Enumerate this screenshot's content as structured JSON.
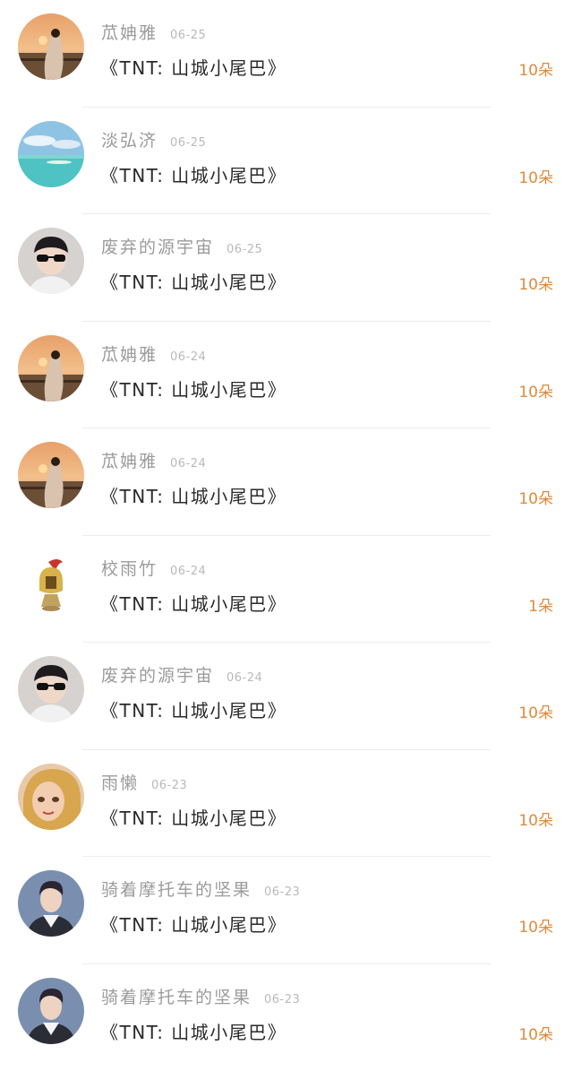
{
  "colors": {
    "accent": "#e08a3c",
    "name": "#9b9b9b",
    "date": "#b9b9b9",
    "title": "#2a2a2a"
  },
  "rows": [
    {
      "name": "苽姌雅",
      "date": "06-25",
      "title": "《TNT: 山城小尾巴》",
      "count": "10朵",
      "avatar": "sunset-girl-avatar"
    },
    {
      "name": "淡弘济",
      "date": "06-25",
      "title": "《TNT: 山城小尾巴》",
      "count": "10朵",
      "avatar": "sea-avatar"
    },
    {
      "name": "废弃的源宇宙",
      "date": "06-25",
      "title": "《TNT: 山城小尾巴》",
      "count": "10朵",
      "avatar": "sunglasses-avatar"
    },
    {
      "name": "苽姌雅",
      "date": "06-24",
      "title": "《TNT: 山城小尾巴》",
      "count": "10朵",
      "avatar": "sunset-girl-avatar"
    },
    {
      "name": "苽姌雅",
      "date": "06-24",
      "title": "《TNT: 山城小尾巴》",
      "count": "10朵",
      "avatar": "sunset-girl-avatar"
    },
    {
      "name": "校雨竹",
      "date": "06-24",
      "title": "《TNT: 山城小尾巴》",
      "count": "1朵",
      "avatar": "helmet-avatar"
    },
    {
      "name": "废弃的源宇宙",
      "date": "06-24",
      "title": "《TNT: 山城小尾巴》",
      "count": "10朵",
      "avatar": "sunglasses-avatar"
    },
    {
      "name": "雨懒",
      "date": "06-23",
      "title": "《TNT: 山城小尾巴》",
      "count": "10朵",
      "avatar": "doll-avatar"
    },
    {
      "name": "骑着摩托车的坚果",
      "date": "06-23",
      "title": "《TNT: 山城小尾巴》",
      "count": "10朵",
      "avatar": "boy-portrait-avatar"
    },
    {
      "name": "骑着摩托车的坚果",
      "date": "06-23",
      "title": "《TNT: 山城小尾巴》",
      "count": "10朵",
      "avatar": "boy-portrait-avatar"
    }
  ]
}
